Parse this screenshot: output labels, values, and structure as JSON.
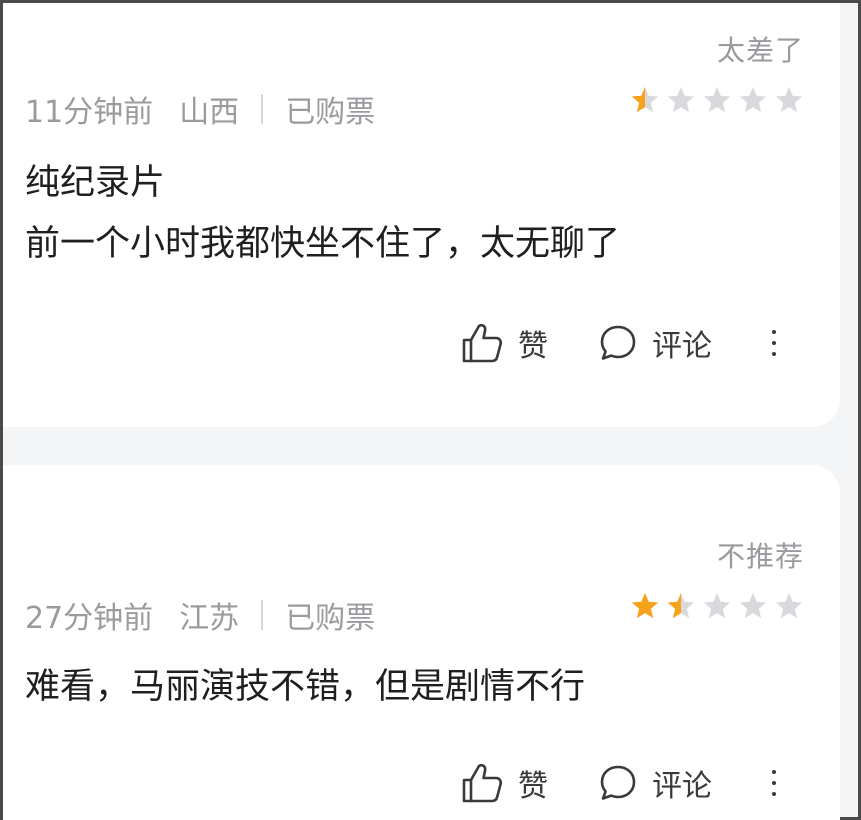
{
  "reviews": [
    {
      "verdict": "太差了",
      "time": "11分钟前",
      "region": "山西",
      "purchase": "已购票",
      "rating": 0.5,
      "lines": [
        "纯纪录片",
        "前一个小时我都快坐不住了，太无聊了"
      ],
      "like_label": "赞",
      "comment_label": "评论"
    },
    {
      "verdict": "不推荐",
      "time": "27分钟前",
      "region": "江苏",
      "purchase": "已购票",
      "rating": 1.5,
      "lines": [
        "难看，马丽演技不错，但是剧情不行"
      ],
      "like_label": "赞",
      "comment_label": "评论"
    }
  ],
  "rating_max": 5,
  "colors": {
    "star_filled": "#f7a21b",
    "star_empty": "#d9d9dd",
    "meta_text": "#9b9b9f",
    "body_text": "#1f1f1f",
    "page_bg": "#f4f5f7"
  }
}
